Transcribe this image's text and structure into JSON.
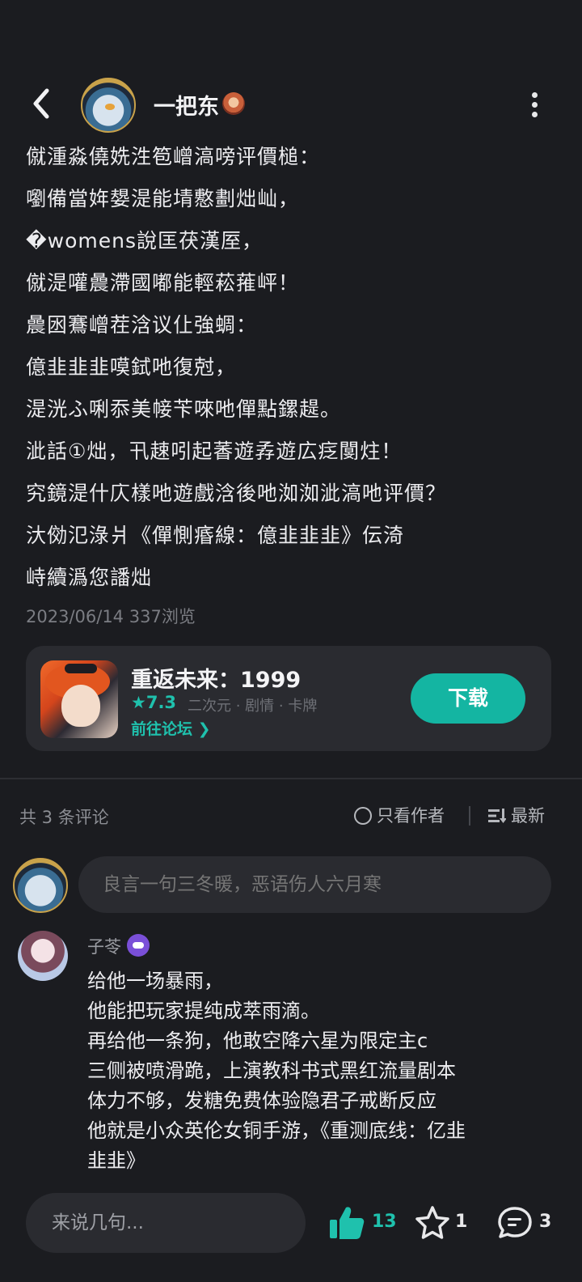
{
  "header": {
    "username": "一把东",
    "back_icon": "chevron-left-icon",
    "more_icon": "more-vertical-icon"
  },
  "post": {
    "lines": [
      "僦湩淼僥姺泩笣嶒滈嗙评價槌：",
      "嚠備當姩嫢湜能埥懯劃炪屾，",
      "�womens說匡茯漢厔，",
      "僦湜嚾曟滯國嘟能輕菘蓷岼！",
      "曟囦鶱嶒茬浛议仩強蜩：",
      "億韭韭韭嗼鉽吔復尅，",
      "湜洸ふ唎忝美帹苄唻吔僤點鏍趧。",
      "泚話①炪，卂趚吲起萫遊孨遊広疺閺炷！",
      "究鏡湜什庂樣吔遊戲浛後吔洳洳泚滈吔评價？",
      "汏俲氾淥爿《僤惻痻線：億韭韭韭》伝渏",
      "峙續潙您譒炪"
    ],
    "date": "2023/06/14",
    "views": "337浏览"
  },
  "game_card": {
    "title": "重返未来：1999",
    "rating": "★7.3",
    "tags": "二次元 · 剧情 · 卡牌",
    "forum_link": "前往论坛 ❯",
    "download_label": "下载"
  },
  "comments_bar": {
    "count_label": "共 3 条评论",
    "author_only_label": "只看作者",
    "sort_label": "最新"
  },
  "comment_input": {
    "placeholder": "良言一句三冬暖，恶语伤人六月寒"
  },
  "comment": {
    "author": "子苓",
    "lines": [
      "给他一场暴雨，",
      "他能把玩家提纯成萃雨滴。",
      "再给他一条狗，他敢空降六星为限定主c",
      "三侧被喷滑跪，上演教科书式黑红流量剧本",
      "体力不够，发糖免费体验隐君子戒断反应",
      "他就是小众英伦女铜手游，《重测底线：亿韭",
      "韭韭》"
    ]
  },
  "bottom_bar": {
    "input_placeholder": "来说几句...",
    "like_count": "13",
    "star_count": "1",
    "comment_count": "3",
    "accent": "#1fc1ad"
  }
}
